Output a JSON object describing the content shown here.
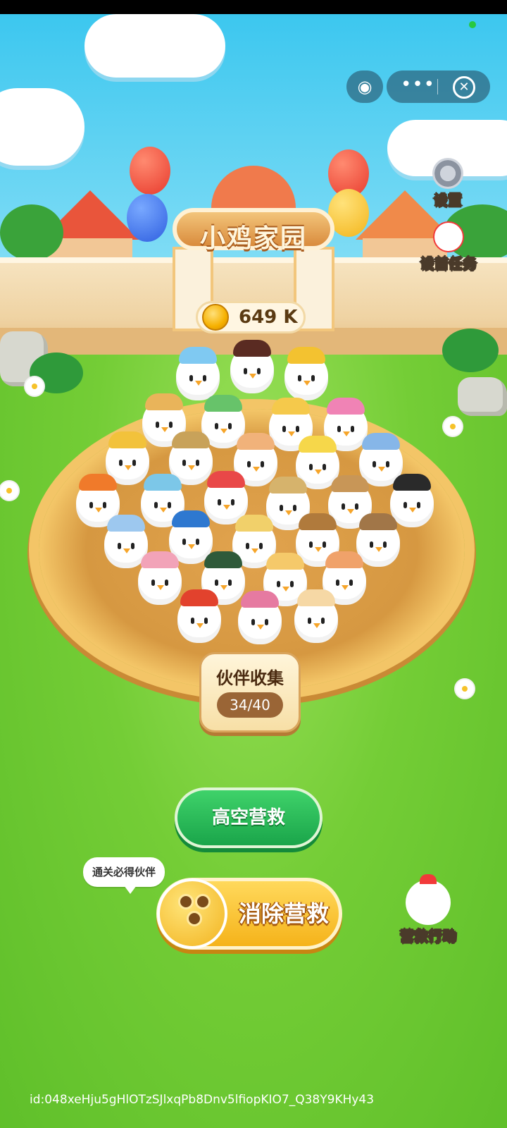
{
  "app": {
    "title": "小鸡家园",
    "coins": "649 K"
  },
  "top_right": {
    "game_icon": "gamepad-icon",
    "more_label": "•••",
    "close_label": "✕"
  },
  "side_menu": {
    "settings_label": "设置",
    "home_task_label": "设首任务"
  },
  "collection": {
    "title": "伙伴收集",
    "count": "34/40"
  },
  "actions": {
    "high_rescue": "高空营救",
    "clear_rescue": "消除营救",
    "bubble_tip": "通关必得伙伴",
    "rescue_action": "营救行动"
  },
  "footer": {
    "id_text": "id:048xeHju5gHlOTzSJlxqPb8Dnv5lfiopKIO7_Q38Y9KHy43"
  },
  "colors": {
    "sky": "#3cc7ef",
    "grass": "#6cc632",
    "green_button": "#1aa54a",
    "yellow_button": "#f5b31a",
    "coin": "#f6b100"
  }
}
